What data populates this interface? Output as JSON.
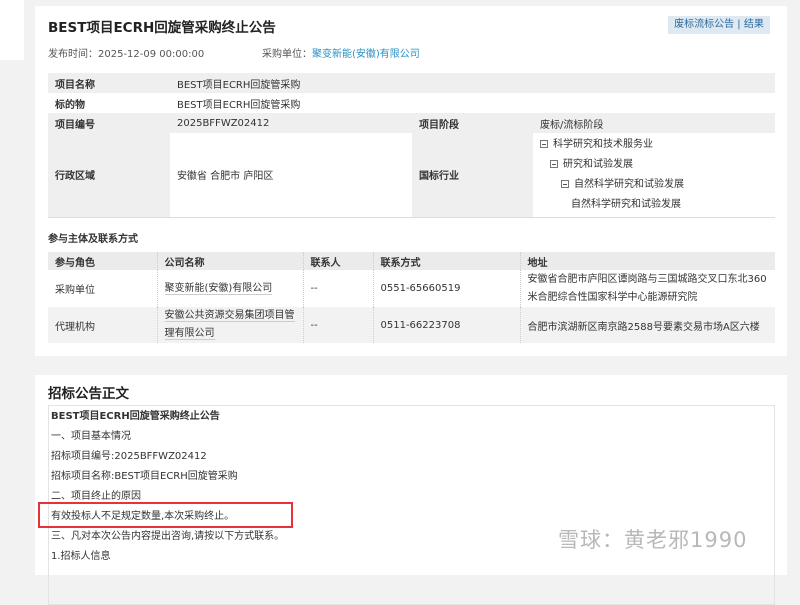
{
  "header": {
    "title": "BEST项目ECRH回旋管采购终止公告",
    "action_button": "废标流标公告 | 结果",
    "publish_label": "发布时间：",
    "publish_time": "2025-12-09 00:00:00",
    "buyer_label": "采购单位：",
    "buyer_name": "聚变新能(安徽)有限公司"
  },
  "info": {
    "project_name_label": "项目名称",
    "project_name": "BEST项目ECRH回旋管采购",
    "subject_label": "标的物",
    "subject": "BEST项目ECRH回旋管采购",
    "project_no_label": "项目编号",
    "project_no": "2025BFFWZ02412",
    "stage_label": "项目阶段",
    "stage": "废标/流标阶段",
    "region_label": "行政区域",
    "region": "安徽省 合肥市 庐阳区",
    "industry_label": "国标行业",
    "industry": [
      "科学研究和技术服务业",
      "研究和试验发展",
      "自然科学研究和试验发展",
      "自然科学研究和试验发展"
    ]
  },
  "contacts": {
    "section_title": "参与主体及联系方式",
    "headers": [
      "参与角色",
      "公司名称",
      "联系人",
      "联系方式",
      "地址"
    ],
    "rows": [
      [
        "采购单位",
        "聚变新能(安徽)有限公司",
        "--",
        "0551-65660519",
        "安徽省合肥市庐阳区谭岗路与三国城路交叉口东北360米合肥综合性国家科学中心能源研究院"
      ],
      [
        "代理机构",
        "安徽公共资源交易集团项目管理有限公司",
        "--",
        "0511-66223708",
        "合肥市滨湖新区南京路2588号要素交易市场A区六楼"
      ]
    ]
  },
  "notice": {
    "section_title": "招标公告正文",
    "lines": [
      "BEST项目ECRH回旋管采购终止公告",
      "一、项目基本情况",
      "招标项目编号:2025BFFWZ02412",
      "招标项目名称:BEST项目ECRH回旋管采购",
      "二、项目终止的原因",
      "有效投标人不足规定数量,本次采购终止。",
      "三、凡对本次公告内容提出咨询,请按以下方式联系。",
      "1.招标人信息"
    ]
  },
  "watermark": "雪球：黄老邪1990"
}
